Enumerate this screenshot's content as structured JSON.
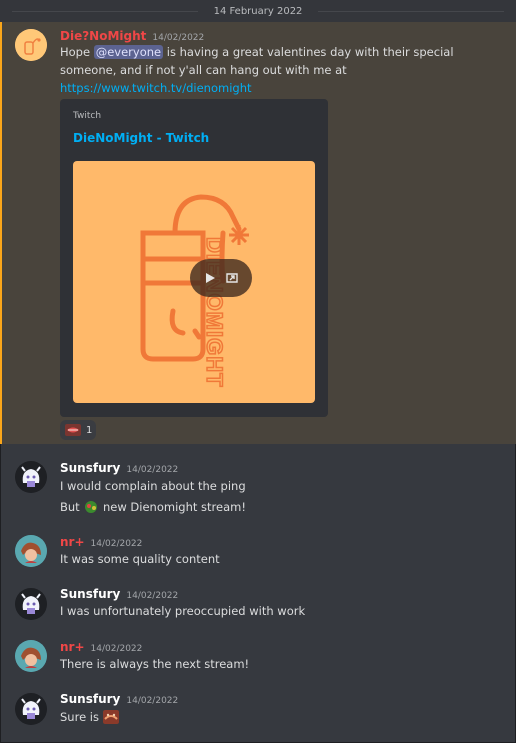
{
  "date_divider": "14 February 2022",
  "colors": {
    "background": "#36393f",
    "mention_highlight": "#49443c",
    "mention_bar": "#faa61a",
    "link": "#00aff4",
    "diemight_name": "#f04747",
    "sunsfury_name": "#ffffff",
    "nr_name": "#f04747"
  },
  "messages": [
    {
      "author": "Die?NoMight",
      "timestamp": "14/02/2022",
      "line1_pre": "Hope ",
      "mention": "@everyone",
      "line1_post": " is having a great valentines day with their special",
      "line2": "someone, and if not y'all can hang out with me at",
      "link": "https://www.twitch.tv/dienomight",
      "embed": {
        "provider": "Twitch",
        "title": "DieNoMight - Twitch",
        "image_text": "DIENOMIGHT"
      },
      "reaction": {
        "emoji": "lips-emoji",
        "count": "1"
      }
    },
    {
      "author": "Sunsfury",
      "timestamp": "14/02/2022",
      "line1": "I would complain about the ping",
      "line2_pre": "But ",
      "line2_post": " new Dienomight stream!"
    },
    {
      "author": "nr+",
      "timestamp": "14/02/2022",
      "line1": "It was some quality content"
    },
    {
      "author": "Sunsfury",
      "timestamp": "14/02/2022",
      "line1": "I was unfortunately preoccupied with work"
    },
    {
      "author": "nr+",
      "timestamp": "14/02/2022",
      "line1": "There is always the next stream!"
    },
    {
      "author": "Sunsfury",
      "timestamp": "14/02/2022",
      "line1_pre": "Sure is "
    }
  ]
}
